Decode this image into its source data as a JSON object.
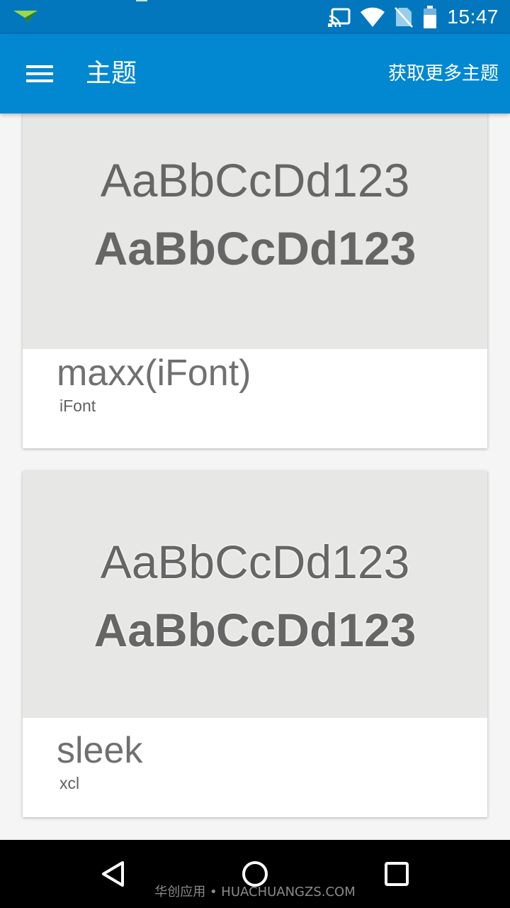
{
  "status_bar": {
    "time": "15:47",
    "icons": [
      "app-notification-icon",
      "cast-icon",
      "wifi-icon",
      "no-sim-icon",
      "battery-icon"
    ]
  },
  "app_bar": {
    "title": "主题",
    "action_label": "获取更多主题",
    "menu_icon": "hamburger-menu-icon"
  },
  "font_cards": [
    {
      "sample_regular": "AaBbCcDd123",
      "sample_bold": "AaBbCcDd123",
      "name": "maxx(iFont)",
      "author": "iFont"
    },
    {
      "sample_regular": "AaBbCcDd123",
      "sample_bold": "AaBbCcDd123",
      "name": "sleek",
      "author": "xcl"
    }
  ],
  "nav_bar": {
    "icons": [
      "back-icon",
      "home-icon",
      "recents-icon"
    ]
  },
  "watermark": "华创应用 • HUACHUANGZS.COM",
  "colors": {
    "status_bar": "#0277bd",
    "app_bar": "#0288d1",
    "preview_background": "#e7e7e5",
    "sample_text": "#666666",
    "page_background": "#f5f5f5",
    "nav_bar": "#000000"
  }
}
